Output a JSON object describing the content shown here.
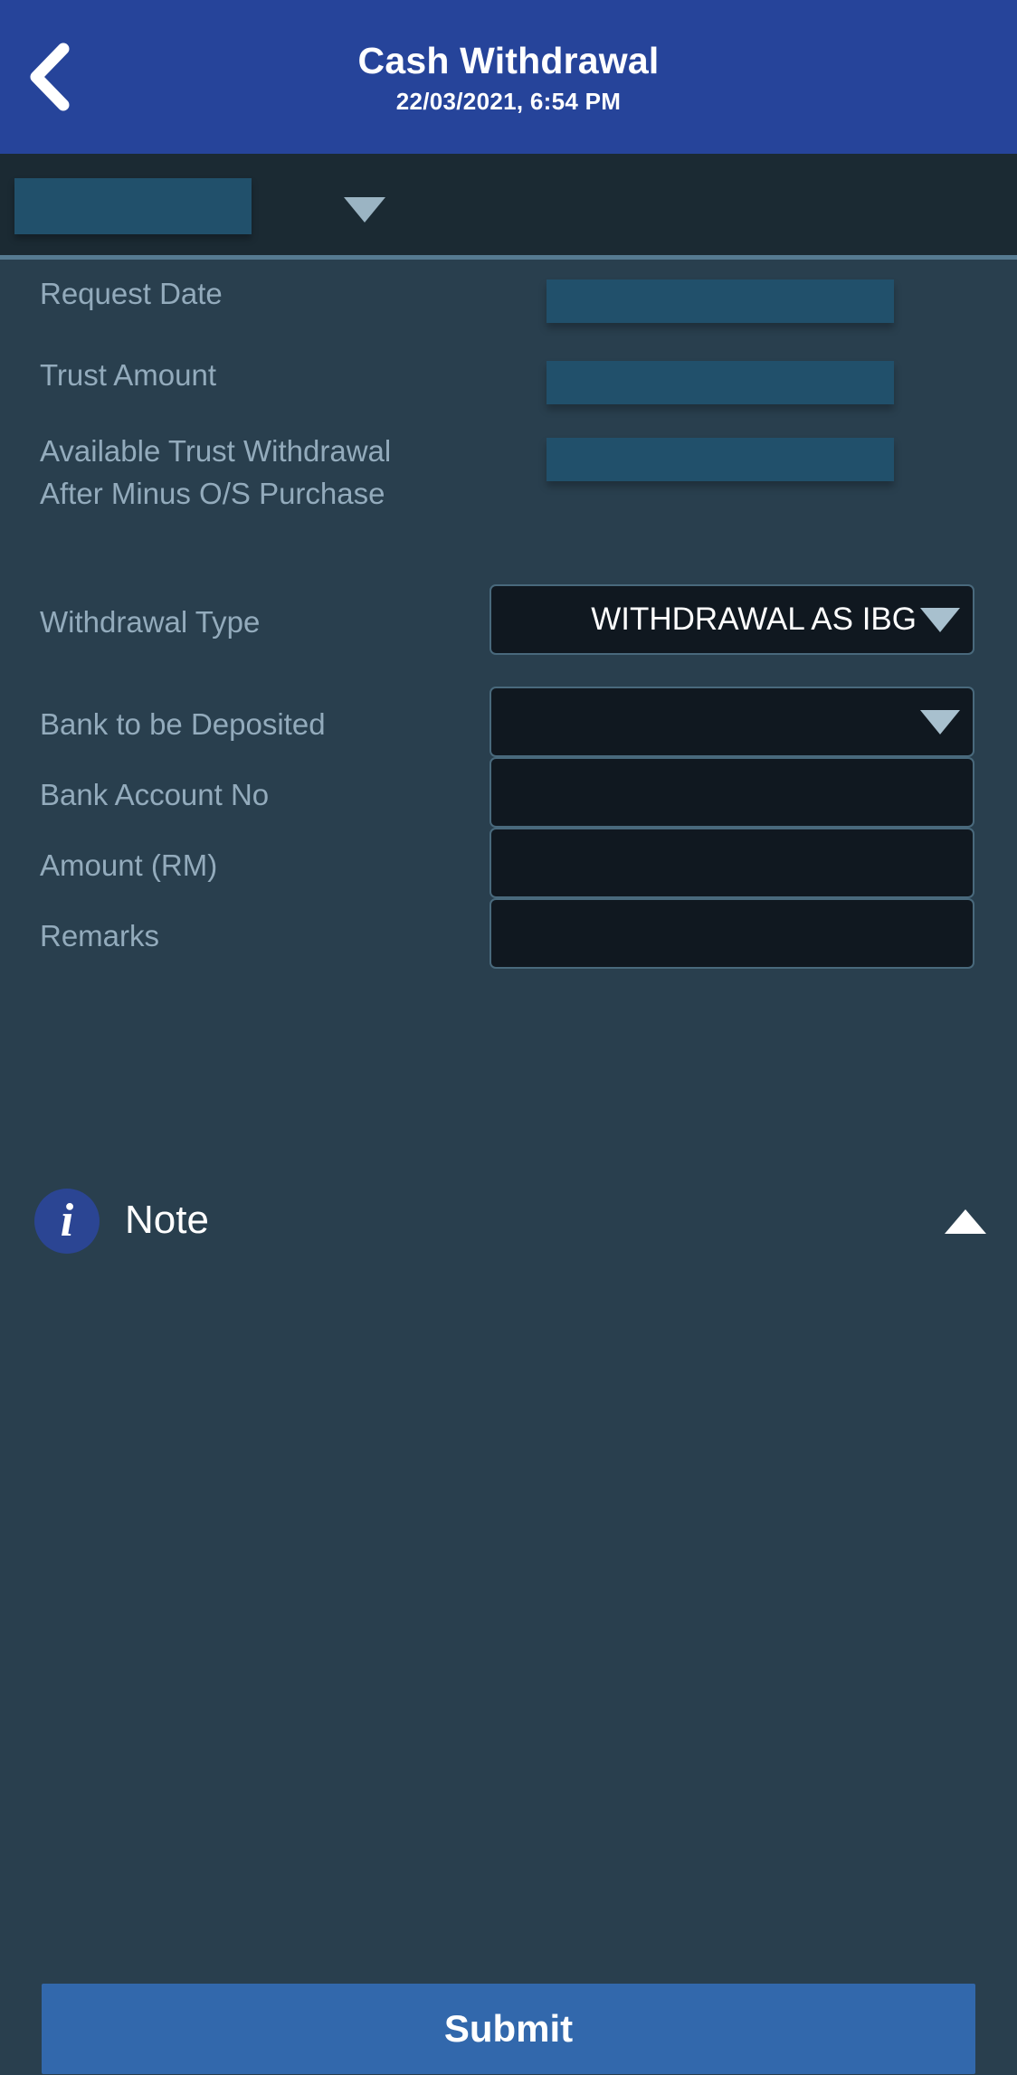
{
  "header": {
    "title": "Cash Withdrawal",
    "subtitle": "22/03/2021, 6:54 PM",
    "back_icon": "chevron-left-icon"
  },
  "subheader": {
    "account_value": "",
    "caret_icon": "caret-down-icon"
  },
  "form": {
    "rows": [
      {
        "label": "Request Date",
        "type": "skeleton",
        "value": ""
      },
      {
        "label": "Trust Amount",
        "type": "skeleton",
        "value": ""
      },
      {
        "label": "Available Trust Withdrawal After Minus O/S Purchase",
        "type": "skeleton",
        "value": ""
      },
      {
        "label": "Withdrawal Type",
        "type": "select",
        "value": "WITHDRAWAL AS IBG",
        "caret_icon": "caret-down-icon"
      },
      {
        "label": "Bank to be Deposited",
        "type": "select",
        "value": "",
        "caret_icon": "caret-down-icon"
      },
      {
        "label": "Bank Account No",
        "type": "text",
        "value": "",
        "placeholder": ""
      },
      {
        "label": "Amount (RM)",
        "type": "text",
        "value": "",
        "placeholder": ""
      },
      {
        "label": "Remarks",
        "type": "text",
        "value": "",
        "placeholder": ""
      }
    ]
  },
  "note": {
    "title": "Note",
    "info_icon_glyph": "i",
    "info_icon": "info-circle-icon",
    "toggle_icon": "caret-up-icon",
    "body": ""
  },
  "footer": {
    "submit_label": "Submit"
  },
  "colors": {
    "header_blue": "#26449a",
    "subheader_dark": "#1b2a33",
    "body_background": "#293f4e",
    "skeleton": "#21506b",
    "field_background": "#101820",
    "field_border": "#49697c",
    "label_text": "#93abbc",
    "submit_blue": "#3268ac",
    "info_badge": "#2b4593"
  }
}
